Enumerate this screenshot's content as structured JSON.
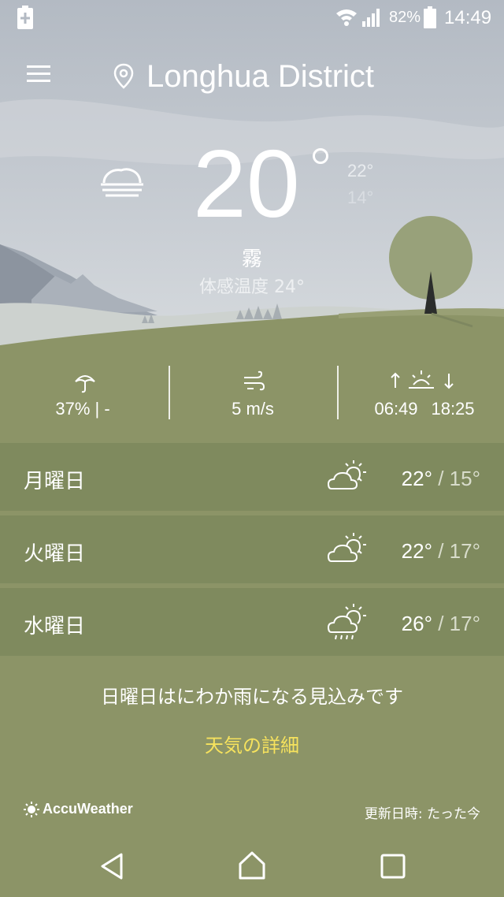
{
  "status_bar": {
    "battery_percent": "82%",
    "time": "14:49"
  },
  "header": {
    "location": "Longhua District",
    "menu_icon": "hamburger-menu-icon",
    "location_icon": "location-pin-icon"
  },
  "current": {
    "temperature": "20",
    "high": "22°",
    "low": "14°",
    "condition": "霧",
    "feels_like": "体感温度 24°",
    "condition_icon": "fog-cloud-icon"
  },
  "stats": {
    "precipitation": "37% | -",
    "wind": "5 m/s",
    "sunrise": "06:49",
    "sunset": "18:25"
  },
  "forecast": [
    {
      "day": "月曜日",
      "high": "22°",
      "low": " / 15°",
      "icon": "partly-sunny-icon"
    },
    {
      "day": "火曜日",
      "high": "22°",
      "low": " / 17°",
      "icon": "partly-sunny-icon"
    },
    {
      "day": "水曜日",
      "high": "26°",
      "low": " / 17°",
      "icon": "sun-cloud-rain-icon"
    }
  ],
  "summary": "日曜日はにわか雨になる見込みです",
  "details_link": "天気の詳細",
  "footer": {
    "brand": "AccuWeather",
    "updated": "更新日時: たった今"
  },
  "colors": {
    "ground": "#8c9467",
    "row_bg": "#7f8a5e",
    "link": "#f6e25d",
    "sky_top": "#b9c0c8"
  }
}
